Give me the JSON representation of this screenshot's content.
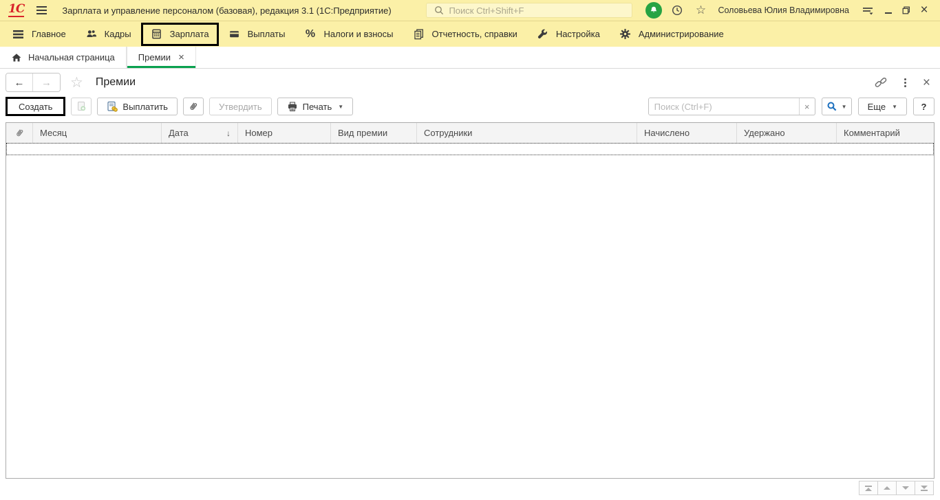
{
  "titlebar": {
    "logo_text": "1С",
    "app_title": "Зарплата и управление персоналом (базовая), редакция 3.1  (1С:Предприятие)",
    "search_placeholder": "Поиск Ctrl+Shift+F",
    "user_name": "Соловьева Юлия Владимировна"
  },
  "sections": {
    "items": [
      {
        "label": "Главное",
        "icon": "menu-bars",
        "highlighted": false
      },
      {
        "label": "Кадры",
        "icon": "people",
        "highlighted": false
      },
      {
        "label": "Зарплата",
        "icon": "calculator",
        "highlighted": true
      },
      {
        "label": "Выплаты",
        "icon": "bank-card",
        "highlighted": false
      },
      {
        "label": "Налоги и взносы",
        "icon": "percent",
        "highlighted": false
      },
      {
        "label": "Отчетность, справки",
        "icon": "report-pages",
        "highlighted": false
      },
      {
        "label": "Настройка",
        "icon": "wrench",
        "highlighted": false
      },
      {
        "label": "Администрирование",
        "icon": "gear",
        "highlighted": false
      }
    ],
    "percent_glyph": "%"
  },
  "tabs": {
    "home": {
      "label": "Начальная страница",
      "icon": "home"
    },
    "active": {
      "label": "Премии",
      "close_glyph": "×",
      "active": true
    }
  },
  "page": {
    "title": "Премии",
    "nav": {
      "back_glyph": "←",
      "forward_glyph": "→"
    },
    "toolbar": {
      "create": "Создать",
      "pay": "Выплатить",
      "approve": "Утвердить",
      "print": "Печать",
      "more": "Еще",
      "help": "?",
      "search_placeholder": "Поиск (Ctrl+F)",
      "search_clear_glyph": "×",
      "caret_glyph": "▼"
    },
    "table": {
      "columns": [
        "Месяц",
        "Дата",
        "Номер",
        "Вид премии",
        "Сотрудники",
        "Начислено",
        "Удержано",
        "Комментарий"
      ],
      "sort": {
        "column": "Дата",
        "glyph": "↓"
      },
      "rows": []
    }
  },
  "glyphs": {
    "star": "☆",
    "close": "×",
    "minimize": "–"
  },
  "colors": {
    "titlebar_bg": "#FBF0A7",
    "tab_accent_green": "#0AA14F",
    "logo_red": "#D8232A",
    "bell_green": "#27A343",
    "search_blue": "#1B6FBE",
    "highlight_box": "#000000"
  }
}
